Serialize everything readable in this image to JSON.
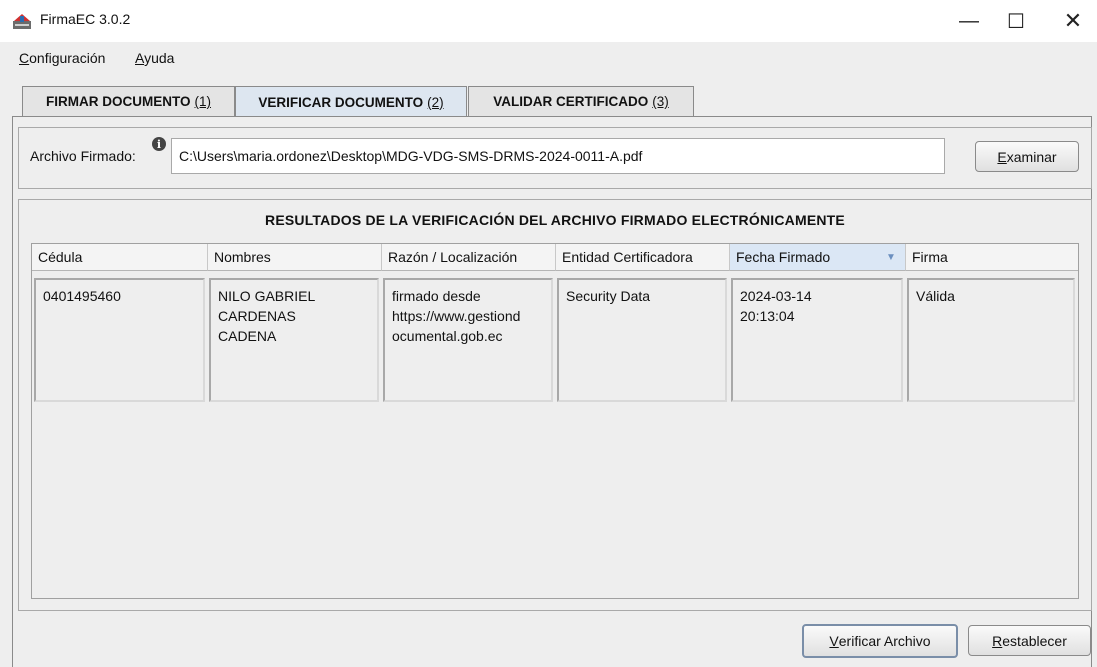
{
  "window": {
    "title": "FirmaEC 3.0.2",
    "icon": "firmaec-app-icon",
    "controls": {
      "minimize": "—",
      "maximize": "☐",
      "close": "✕"
    }
  },
  "menu": [
    {
      "mnemonic": "C",
      "rest": "onfiguración"
    },
    {
      "mnemonic": "A",
      "rest": "yuda"
    }
  ],
  "tabs": [
    {
      "label": "FIRMAR DOCUMENTO",
      "shortcut": "(1)",
      "active": false
    },
    {
      "label": "VERIFICAR DOCUMENTO",
      "shortcut": "(2)",
      "active": true
    },
    {
      "label": "VALIDAR CERTIFICADO",
      "shortcut": "(3)",
      "active": false
    }
  ],
  "file": {
    "label": "Archivo Firmado:",
    "info_icon": "i",
    "value": "C:\\Users\\maria.ordonez\\Desktop\\MDG-VDG-SMS-DRMS-2024-0011-A.pdf",
    "browse_mnemonic": "E",
    "browse_rest": "xaminar"
  },
  "results": {
    "title": "RESULTADOS DE LA VERIFICACIÓN DEL ARCHIVO FIRMADO ELECTRÓNICAMENTE",
    "columns": [
      "Cédula",
      "Nombres",
      "Razón / Localización",
      "Entidad Certificadora",
      "Fecha Firmado",
      "Firma"
    ],
    "sorted_column": "Fecha Firmado",
    "sort_arrow": "▼",
    "rows": [
      {
        "cedula": "0401495460",
        "nombres": "NILO GABRIEL\nCARDENAS\nCADENA",
        "razon": "firmado desde\nhttps://www.gestiond\nocumental.gob.ec",
        "entidad": "Security Data",
        "fecha": "2024-03-14\n20:13:04",
        "firma": "Válida"
      }
    ]
  },
  "actions": {
    "verificar_mnemonic": "V",
    "verificar_rest": "erificar Archivo",
    "restablecer_mnemonic": "R",
    "restablecer_rest": "establecer"
  }
}
